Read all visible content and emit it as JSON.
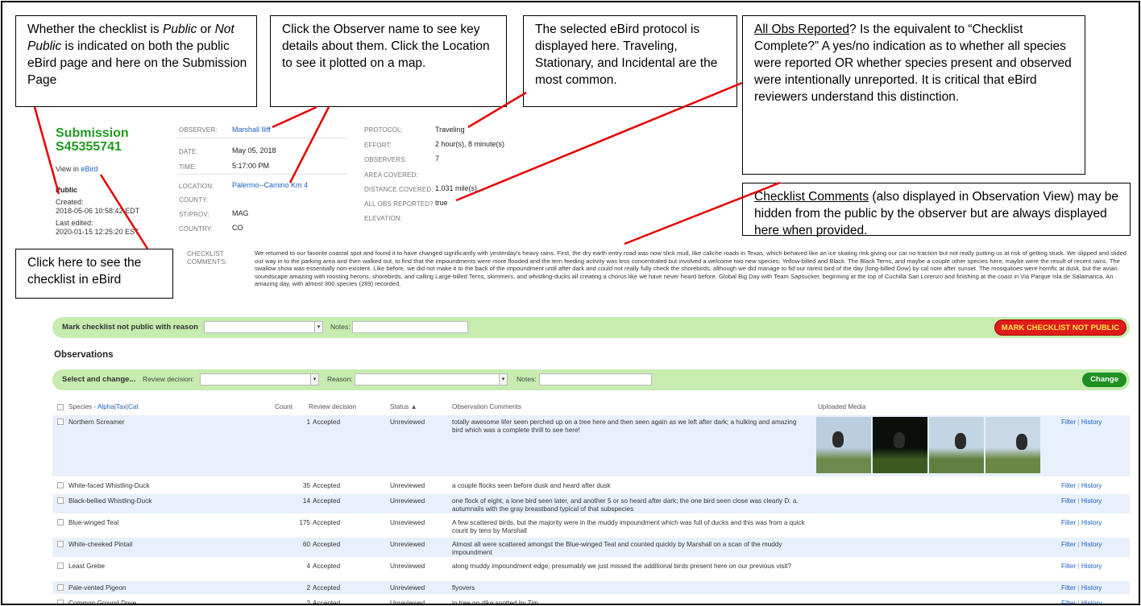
{
  "callouts": {
    "public": {
      "p1": "Whether the checklist is ",
      "p2": "Public",
      "p3": " or ",
      "p4": "Not Public",
      "p5": " is indicated on both the public eBird page and here on the Submission Page"
    },
    "observer": "Click the Observer name to see key details about them. Click the Location to see it plotted on a map.",
    "protocol": "The selected eBird protocol is displayed here. Traveling, Stationary, and Incidental are the most common.",
    "allobs": {
      "u": "All Obs Reported",
      "rest": "? Is the equivalent to “Checklist Complete?” A yes/no indication as to whether all species were reported OR whether species present and observed were intentionally unreported. It is critical that eBird reviewers understand this distinction."
    },
    "comments": {
      "u": "Checklist Comments",
      "rest": " (also displayed in Observation View) may be hidden from the public by the observer but are always displayed here when provided."
    },
    "ebird": "Click here to see the checklist in eBird"
  },
  "summary": {
    "title_line1": "Submission",
    "title_line2": "S45355741",
    "view_in": "View in ",
    "ebird_link": "eBird",
    "visibility": "Public",
    "created_label": "Created:",
    "created": "2018-05-06 10:58:42 EDT",
    "edited_label": "Last edited:",
    "edited": "2020-01-15 12:25:20 EST"
  },
  "details": {
    "observer_label": "OBSERVER:",
    "observer": "Marshall Iliff",
    "date_label": "DATE:",
    "date": "May 05, 2018",
    "time_label": "TIME:",
    "time": "5:17:00 PM",
    "location_label": "LOCATION:",
    "location": "Palermo--Camino Km 4",
    "county_label": "COUNTY:",
    "county": "",
    "stprov_label": "ST/PROV:",
    "stprov": "MAG",
    "country_label": "COUNTRY:",
    "country": "CO",
    "protocol_label": "PROTOCOL:",
    "protocol": "Traveling",
    "effort_label": "EFFORT:",
    "effort": "2 hour(s), 8 minute(s)",
    "observers_label": "OBSERVERS:",
    "observers": "7",
    "area_label": "AREA COVERED:",
    "area": "",
    "distance_label": "DISTANCE COVERED:",
    "distance": "1.031 mile(s)",
    "allobs_label": "ALL OBS REPORTED?",
    "allobs": "true",
    "elevation_label": "ELEVATION:",
    "elevation": "",
    "comments_label1": "CHECKLIST",
    "comments_label2": "COMMENTS:",
    "comments": "We returned to our favorite coastal spot and found it to have changed significantly with yesterday's heavy rains. First, the dry earth entry road was now slick mud, like caliche roads in Texas, which behaved like an ice skating rink giving our car no traction but not really putting us at risk of getting stuck. We slipped and slided our way in to the parking area and then walked out, to find that the impoundments were more flooded and the tern feeding activity was less concentrated but involved a welcome two new species: Yellow-billed and Black. The Black Terns, and maybe a couple other species here, maybe were the result of recent rains. The swallow show was essentially non-existent. Like before, we did not make it to the back of the impoundment until after dark and could not really fully check the shorebirds, although we did manage to fid our rarest bird of the day (long-billed Dow) by cal note after sunset. The mosquitoes were horrific at dusk, but the avian soundscape amazing with roosting herons, shorebirds, and calling Large-billed Terns, skimmers, and whistling-ducks all creating a chorus like we have never heard before. Global Big Day with Team Sapsucker, beginning at the top of Cuchilla San Lorenzo and finishing at the coast in Via Parque Isla de Salamanca. An amazing day, with almost 300 species (289) recorded."
  },
  "mark_bar": {
    "label": "Mark checklist not public with reason",
    "notes_label": "Notes:",
    "button": "MARK CHECKLIST NOT PUBLIC"
  },
  "observations_heading": "Observations",
  "change_bar": {
    "label": "Select and change...",
    "review_label": "Review decision:",
    "reason_label": "Reason:",
    "notes_label": "Notes:",
    "button": "Change"
  },
  "table": {
    "headers": {
      "species": "Species - ",
      "alpha": "Alpha",
      "tax": "Tax",
      "cat": "Cat",
      "count": "Count",
      "review": "Review decision",
      "status": "Status ▲",
      "comments": "Observation Comments",
      "media": "Uploaded Media"
    },
    "filter": "Filter",
    "history": "History",
    "rows": [
      {
        "species": "Northern Screamer",
        "count": "1",
        "decision": "Accepted",
        "status": "Unreviewed",
        "comment": "totally awesome lifer seen perched up on a tree here and then seen again as we left after dark; a hulking and amazing bird which was a complete thrill to see here!"
      },
      {
        "species": "White-faced Whistling-Duck",
        "count": "35",
        "decision": "Accepted",
        "status": "Unreviewed",
        "comment": "a couple flocks seen before dusk and heard after dusk"
      },
      {
        "species": "Black-bellied Whistling-Duck",
        "count": "14",
        "decision": "Accepted",
        "status": "Unreviewed",
        "comment": "one flock of eight, a lone bird seen later, and another 5 or so heard after dark; the one bird seen close was clearly D. a. autumnalis with the gray breastband typical of that subspecies"
      },
      {
        "species": "Blue-winged Teal",
        "count": "175",
        "decision": "Accepted",
        "status": "Unreviewed",
        "comment": "A few scattered birds, but the majority were in the muddy impoundment which was full of ducks and this was from a quick count by tens by Marshall"
      },
      {
        "species": "White-cheeked Pintail",
        "count": "60",
        "decision": "Accepted",
        "status": "Unreviewed",
        "comment": "Almost all were scattered amongst the Blue-winged Teal and counted quickly by Marshall on a scan of the muddy impoundment"
      },
      {
        "species": "Least Grebe",
        "count": "4",
        "decision": "Accepted",
        "status": "Unreviewed",
        "comment": "along muddy impoundment edge; presumably we just missed the additional birds present here on our previous visit?"
      },
      {
        "species": "Pale-vented Pigeon",
        "count": "2",
        "decision": "Accepted",
        "status": "Unreviewed",
        "comment": "flyovers"
      },
      {
        "species": "Common Ground Dove",
        "count": "2",
        "decision": "Accepted",
        "status": "Unreviewed",
        "comment": "in tree on dike spotted by Tim"
      }
    ]
  }
}
